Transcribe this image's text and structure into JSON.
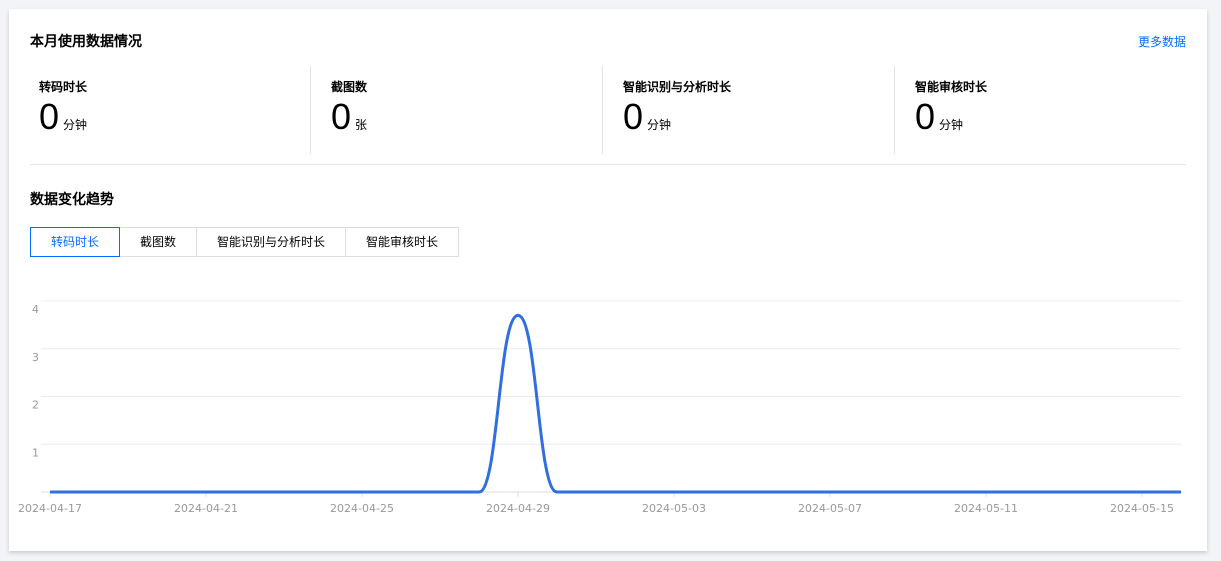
{
  "header": {
    "title": "本月使用数据情况",
    "more_link": "更多数据"
  },
  "stats": [
    {
      "label": "转码时长",
      "value": "0",
      "unit": "分钟"
    },
    {
      "label": "截图数",
      "value": "0",
      "unit": "张"
    },
    {
      "label": "智能识别与分析时长",
      "value": "0",
      "unit": "分钟"
    },
    {
      "label": "智能审核时长",
      "value": "0",
      "unit": "分钟"
    }
  ],
  "trend": {
    "title": "数据变化趋势",
    "tabs": [
      {
        "label": "转码时长",
        "active": true
      },
      {
        "label": "截图数",
        "active": false
      },
      {
        "label": "智能识别与分析时长",
        "active": false
      },
      {
        "label": "智能审核时长",
        "active": false
      }
    ]
  },
  "colors": {
    "accent": "#006eff",
    "line": "#2f6fe0",
    "grid": "#ececec"
  },
  "chart_data": {
    "type": "line",
    "x": [
      "2024-04-17",
      "2024-04-18",
      "2024-04-19",
      "2024-04-20",
      "2024-04-21",
      "2024-04-22",
      "2024-04-23",
      "2024-04-24",
      "2024-04-25",
      "2024-04-26",
      "2024-04-27",
      "2024-04-28",
      "2024-04-29",
      "2024-04-30",
      "2024-05-01",
      "2024-05-02",
      "2024-05-03",
      "2024-05-04",
      "2024-05-05",
      "2024-05-06",
      "2024-05-07",
      "2024-05-08",
      "2024-05-09",
      "2024-05-10",
      "2024-05-11",
      "2024-05-12",
      "2024-05-13",
      "2024-05-14",
      "2024-05-15",
      "2024-05-16"
    ],
    "series": [
      {
        "values": [
          0,
          0,
          0,
          0,
          0,
          0,
          0,
          0,
          0,
          0,
          0,
          0,
          3.7,
          0,
          0,
          0,
          0,
          0,
          0,
          0,
          0,
          0,
          0,
          0,
          0,
          0,
          0,
          0,
          0,
          0
        ]
      }
    ],
    "x_tick_labels": [
      "2024-04-17",
      "2024-04-21",
      "2024-04-25",
      "2024-04-29",
      "2024-05-03",
      "2024-05-07",
      "2024-05-11",
      "2024-05-15"
    ],
    "y_ticks": [
      1,
      2,
      3,
      4
    ],
    "ylim": [
      0,
      4
    ],
    "grid": true
  }
}
